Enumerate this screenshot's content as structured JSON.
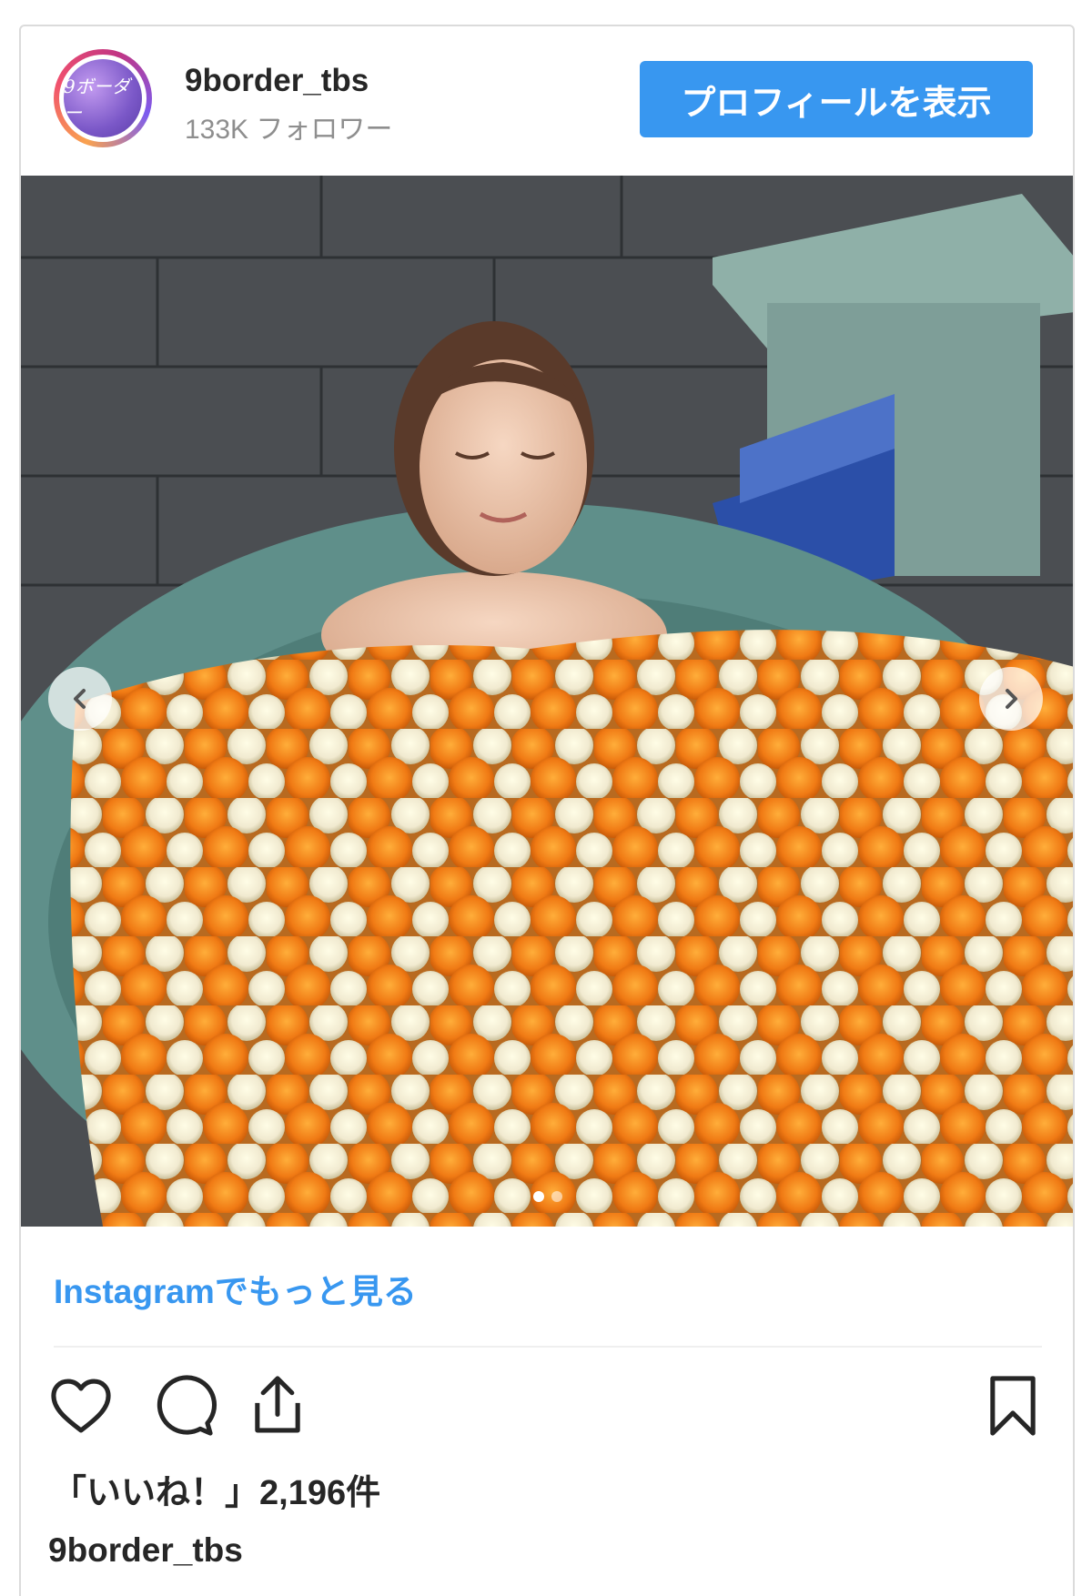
{
  "post": {
    "username": "9border_tbs",
    "followers": "133K フォロワー",
    "profile_button": "プロフィールを表示",
    "avatar_text": "9ボーダー",
    "more_link": "Instagramでもっと見る",
    "likes": "「いいね！」2,196件",
    "caption_username": "9border_tbs",
    "carousel": {
      "total": 2,
      "current": 1
    }
  },
  "icons": {
    "like": "heart-icon",
    "comment": "comment-icon",
    "share": "share-icon",
    "save": "bookmark-icon",
    "prev": "chevron-left-icon",
    "next": "chevron-right-icon"
  },
  "colors": {
    "accent": "#3897f0",
    "text": "#262626",
    "muted": "#8e8e8e"
  }
}
